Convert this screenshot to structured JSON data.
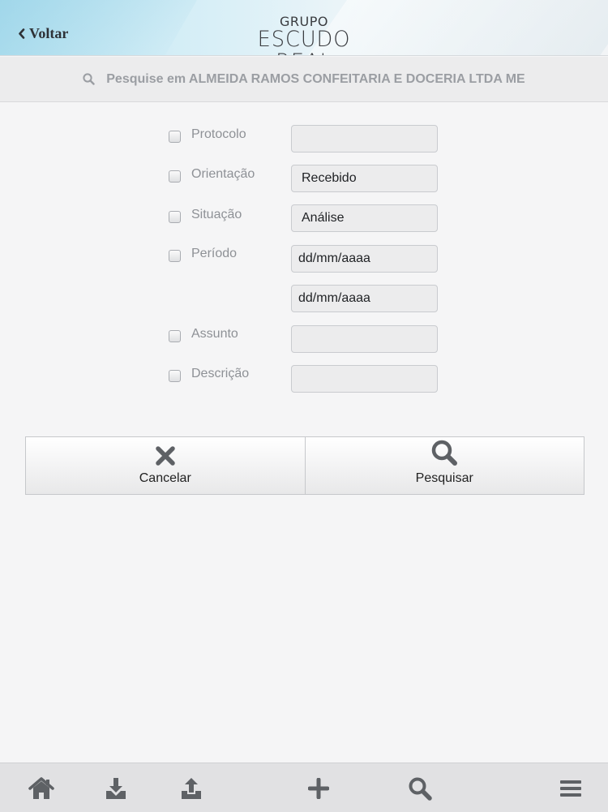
{
  "header": {
    "back_label": "Voltar",
    "logo_line1": "GRUPO",
    "logo_line2": "ESCUDO REAL"
  },
  "search": {
    "text": "Pesquise em ALMEIDA RAMOS CONFEITARIA E DOCERIA LTDA ME",
    "icon": "search-icon"
  },
  "form": {
    "protocolo": {
      "label": "Protocolo",
      "value": ""
    },
    "orientacao": {
      "label": "Orientação",
      "value": "Recebido"
    },
    "situacao": {
      "label": "Situação",
      "value": "Análise"
    },
    "periodo": {
      "label": "Período",
      "from": "dd/mm/aaaa",
      "to": "dd/mm/aaaa"
    },
    "assunto": {
      "label": "Assunto",
      "value": ""
    },
    "descricao": {
      "label": "Descrição",
      "value": ""
    }
  },
  "actions": {
    "cancel": {
      "label": "Cancelar",
      "icon": "close-icon"
    },
    "search": {
      "label": "Pesquisar",
      "icon": "search-icon"
    }
  },
  "tabbar": {
    "icons": [
      "home-icon",
      "download-icon",
      "upload-icon",
      "add-icon",
      "search-icon",
      "menu-icon"
    ]
  },
  "colors": {
    "background": "#f5f5f6",
    "icon_gray": "#5e6165",
    "label_gray": "#8e9196"
  }
}
